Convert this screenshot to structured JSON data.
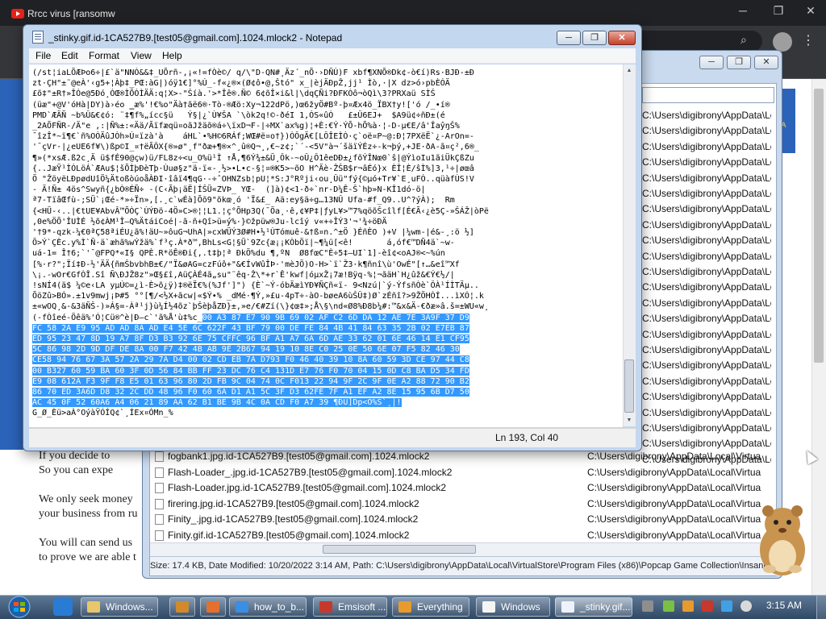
{
  "browser": {
    "tab_title": "Rrcc virus [ransomw",
    "caption_min": "─",
    "caption_max": "❐",
    "caption_close": "✕",
    "page_lines": [
      "If you decide to",
      "So you can expe",
      "We only seek money",
      "your business from ru",
      "You will can send us",
      "to prove we are able t"
    ],
    "side_badge": "CA\nA\nC"
  },
  "explorer": {
    "files": [
      {
        "name": "fogbank1.jpg.id-1CA527B9.[test05@gmail.com].1024.mlock2",
        "path": "C:\\Users\\digibrony\\AppData\\Local\\Virtua"
      },
      {
        "name": "Flash-Loader_.jpg.id-1CA527B9.[test05@gmail.com].1024.mlock2",
        "path": "C:\\Users\\digibrony\\AppData\\Local\\Virtua"
      },
      {
        "name": "Flash-Loader.jpg.id-1CA527B9.[test05@gmail.com].1024.mlock2",
        "path": "C:\\Users\\digibrony\\AppData\\Local\\Virtua"
      },
      {
        "name": "firering.jpg.id-1CA527B9.[test05@gmail.com].1024.mlock2",
        "path": "C:\\Users\\digibrony\\AppData\\Local\\Virtua"
      },
      {
        "name": "Finity_.jpg.id-1CA527B9.[test05@gmail.com].1024.mlock2",
        "path": "C:\\Users\\digibrony\\AppData\\Local\\Virtua"
      },
      {
        "name": "Finity.gif.id-1CA527B9.[test05@gmail.com].1024.mlock2",
        "path": "C:\\Users\\digibrony\\AppData\\Local\\Virtua"
      }
    ],
    "right_paths": [
      "C:\\Users\\digibrony\\AppData\\Local\\Virtua",
      "C:\\Users\\digibrony\\AppData\\Local\\Virtua",
      "C:\\Users\\digibrony\\AppData\\Local\\Virtua",
      "C:\\Users\\digibrony\\AppData\\Local\\Virtua",
      "C:\\Users\\digibrony\\AppData\\Local\\Virtua",
      "C:\\Users\\digibrony\\AppData\\Local\\Virtua",
      "C:\\Users\\digibrony\\AppData\\Local\\Virtua",
      "C:\\Users\\digibrony\\AppData\\Local\\Virtua",
      "C:\\Users\\digibrony\\AppData\\Local\\Virtua",
      "C:\\Users\\digibrony\\AppData\\Local\\Virtua",
      "C:\\Users\\digibrony\\AppData\\Local\\Virtua",
      "C:\\Users\\digibrony\\AppData\\Local\\Virtua",
      "C:\\Users\\digibrony\\AppData\\Local\\Virtua",
      "C:\\Users\\digibrony\\AppData\\Local\\Virtua",
      "C:\\Users\\digibrony\\AppData\\Local\\Virtua",
      "C:\\Users\\digibrony\\AppData\\Local\\Virtua",
      "C:\\Users\\digibrony\\AppData\\Local\\Virtua",
      "C:\\Users\\digibrony\\AppData\\Local\\Virtua",
      "C:\\Users\\digibrony\\AppData\\Local\\Virtua",
      "C:\\Users\\digibrony\\AppData\\Local\\Virtua",
      "C:\\Users\\digibrony\\AppData\\Local\\Virtua",
      "C:\\Users\\digibrony\\AppData\\Local\\Virtua",
      "C:\\Users\\digibrony\\AppData\\Local\\Virtua"
    ],
    "status": "Size: 17.4 KB, Date Modified: 10/20/2022 3:14 AM, Path: C:\\Users\\digibrony\\AppData\\Local\\VirtualStore\\Program Files (x86)\\Popcap Game Collection\\Insaniq",
    "min": "─",
    "max": "❐",
    "close": "✕"
  },
  "notepad": {
    "title": "_stinky.gif.id-1CA527B9.[test05@gmail.com].1024.mlock2 - Notepad",
    "menus": [
      "File",
      "Edit",
      "Format",
      "View",
      "Help"
    ],
    "min": "─",
    "max": "❐",
    "close": "✕",
    "status_position": "Ln 193, Col 40",
    "lines": [
      {
        "t": "(/st¦iaLÕÆÞo6÷|£`ä\"NNÒ&&‡_UÕrñ-,¡«!=fÒè©/ q/\\\"D-QN#¸Äz´_nÕ·›DÑÙ)F xbf¶XNÕ®Dk¢-ò€í)Rs·BJÐ-±Ð"
      },
      {
        "t": "zt·ÇH\"±˜@eÀ'‹g5+¦Àþ‡_PŒ:àG|)óÿ1€]°%Ú_-f«¿®×(Ø¢ô•@,Štó\" x_|èjÄÐpŽ,jj¹ Ìò,·|X dz>ó›pbÈÓÄ"
      },
      {
        "t": "£õ‡\"±R†»ÎÓe@5Ðó¸ÓŒ®ÌÕÒÌÄÄ:q¦X>-\"Šíà.'>*Îê®.Ñ© 6¢õÎ×i&l|\\dqÇÑi?ÐFKÒô¬òQì\\3?PRXaü SÌŠ"
      },
      {
        "t": "(üæ\"+@V'óHà|DY)à›éo ‗æ%'!€%o\"Äà†ãë6®·Tò-®Æö:Xy¬122dPö,)œ6žyÖ#Bº-þ¤Æx4ö_ÏBX†y!['ó /_•í®"
      },
      {
        "t": "PMD`ÆÄÑ ~b%Û&€¢ó: ¨‡¶f%„ícc§ü   Ý§|¿`Ù¥ŠA `\\òk2q!©-ðéI 1,ÓS«ûÒ   £±Û6EJ+  $A9ü¢÷ñÐ±(é"
      },
      {
        "t": "_2AÕFÑR-/Ä\"e ,:|Ñ%±:«Ää/Ãïfæqü¤oãJžäõ®á÷\\ïxD¬F-|÷MX`ax%g)¦+È:€Ý·ÝÕ-hÕ%à·¦-D-µ€E/â'ÎaŷŋŠ%"
      },
      {
        "t": "¯îzÎ*~ï¶€`ñ%OÒÄûJÒh»Ú¤ïzà'à    áHL`•%H©6RÁf;WŒ#ë¤o†})ÒÔgÄ€[LÔÎEÌÒ·ç`oë¤P~@:Ð¦7PXëË`¿-ArOn=-"
      },
      {
        "t": "'¯çVr·|¿eUE6f¥\\)ßp©I_¤†ëÃÔX{®»ø\"¸f\"ðæ+¶®×^¸û®Q¬¸,€~z¢;`´-<5V\"à¬´šäïÝÉz÷-k¬þý,+JE·ðA-ã¤ç²,6®_"
      },
      {
        "t": "¶»(*xsÆ.ß2c¸Ä ü$fÉ90@çw)ü/FL8z÷<u_O%ü¹Ì ↑Å,¶6Ý¾±&Ü¸Ôk-~oÛ¿Ô1êeDÐ±¿fõÝÎNœ0`ŝ|@ÝìoIu1ãiÜkÇßZu"
      },
      {
        "t": "{..JæŸ¹ÌÓLöÁ`ÆAu$¦šÕÌþÐèTþ·Ùuø§z\"ä-ï«-¸½>•L•c-§¦¤®K5>~õO H^Äè-ŽŠB$r¬âÉó}x ÈÎ¦È/ŝÌ%]3,¹÷|øœâ"
      },
      {
        "t": "Ö \"ŽöyëLÐpødUîÖ¼ÄtoßòúoåÀÐI·îâï4¶qG·-÷ˆOHNZsb¦pU¦*S:J°Rºji‹ou¸Ûü\"fý{©µó+Tr¥`E¸uFÓ..qüàfÙS!V"
      },
      {
        "t": "- Ä!Ñ± 4ös^Swyñ{¿bÒ®ÉÑ÷ -(C‹Ãþ¡äË|ÍŠÜ«ZVÞ_ YŒ-  (]à)¢<1-ð÷`nr-D¼Ê-Š`hþ»N-KÎ1dó-ö|"
      },
      {
        "t": "ª7-TïâŒfù-;SÜ`¡Œé-*»÷Ïn»,[.¸c`wÉà]Õõ9\"õkœ¸ó 'Ï&£_ Aä:ey§ä÷g…13NÛ Ufa-#f_Q9..U^?ýÀ);  Rm"
      },
      {
        "t": "{<HÜ-‹..|€tUE¥AbvÂ™ÕÒÇ`ÙÝÐö-4Ö»C>®¦¦L1.¦ç°ÕHp3Q(¯Öa¸·ê,¢¥P‡|ƒyL¥>™7%qöõŠcîlf[É€Ã‹¿è5Ç-»ŠÁŽ|òPë"
      },
      {
        "t": ",0e%ÖÕ'ÎUÌÉ ½õ¢ÀM¹Î—Q%ÄtáiCoé|-ã-ñ+Qî>ü=ý%·}©žpüw®Ju-lcîý v«+÷ÎÝ3'¬'¾÷öÐÄ"
      },
      {
        "t": "'†9*-qzk-¼€0ªÇ58ªiÉU¿ã%!äU~»ôuG¬UhA|»cxWÜÝ3Ø#H•½¹ÙTómuê-&†ß¤n.^±Ö }ÉñÈO )+V |¼wm-|é&-¸:ö ½]"
      },
      {
        "t": "Ö>Ý`ÇÈc.y%Ì`Ñ·ä`æhã%wÝžä%`f³ç.À*ð™,BhLs<G¦§Ü`9Zc{æ¡¡KÒbÖï|~¶¼ü[<ê!       á,óf€™DÑ4ä`~w-"
      },
      {
        "t": "uá-1= Î†6;`'¯@FPQ*«I§ QPÈ.R*öÊ®Ði{,.t‡þ¦ª ÐkÖ%du ¶,ºN  Ø8fœC\"È÷5‡—UI`1]-èî¢<oAJ®<~%ún"
      },
      {
        "t": "[%·r?\";Ïí‡Ð-½'ÄÄ{ñmŠbvbhB±€/\"Ï&øAG=czFúô+\"&€ÍvWûÎÞ·'mèJÖ)O-H>`ï`Ž3·k¶ñnî\\ù'OwÉ\"[↑…&eî™Xf"
      },
      {
        "t": "\\¡.-wOr€GfÒÎ.Sî Ñ\\ÐJŽ8z\"»Œ§£î,AüÇÀÉ4ã„su\"¨êq·Ž\\*+r`Ê'kwf|óµxŽ¡7æ!Bÿq-%¦¬ãäH`H¿ûž&€Ý€½/|"
      },
      {
        "t": "!sNÍ4(ä$ ¼©e‹LA yµÚ©=¿ì-È>õ¿ÿ)‡®ëÏ€%(%Jf']\") {È`~Ý-óbÄæìYÐ¥ÑÇñ«ï- 9<Nzú|`ý-ÝfsñÒè`ÔÀ¹ÍÌTÄµ.."
      },
      {
        "t": "ÕöZû>BÓ».±1v9mwj¡Þ#5 °°[¶/<½X+ãcw|«$Ý•% _dMé·¶Ý,»£u-4pT÷-àO-bøeA6ùŠÛ‡)Ø`zÉñî?>9ŽÖHÓÍ...ìXÓ¦.k"
      },
      {
        "t": "±«wOQ¸&-&3äÑŠ-)»Á§=-Àª¹j}ù¼Í½4õz`þŠèþåZÐ}±,»e/€#Zí(\\}¢œ‡»;Å\\§\\nd«Ø8%Ð8b¼#:™&x&Ä-€ðæ»â.š=±WU«w¸"
      },
      {
        "t": "(-fÒîeé-Öêä%'Ó¦Cü®^è|Ð—c`'ã%Å'ù‡%c_",
        "h": "00 A3 87 E7 90 9B 69 02 AF C2 6D DA 12 AE 7E 3A9F 37 D9"
      },
      {
        "h": "FC 58 2A E9 95 AD AD 8A AD E4 5E 6C 622F 43 BF 79 00 DE FE 84 4B 41 84 63 35 2B 02 E7EB 87"
      },
      {
        "h": "ED 95 23 47 8D 19 A7 8F D3 B3 92 6E 75 CFFC 96 BF A1 A7 6A 6D AE 33 62 01 6E 46 14 E1 CF95"
      },
      {
        "h": "5C 86 98 2D 9D DF DE 8A 00 F7 42 4B AB 9E 2B67 94 19 10 8E C0 25 0E 50 6E 07 F5 82 46 30"
      },
      {
        "h": "CE58 94 76 67 3A 57 2A 29 7A D4 00 02 CD EB 7A D793 F0 46 40 39 10 8A 60 59 3D CE 97 44 C8"
      },
      {
        "h": "00 B327 60 59 BA 60 3F 0D 56 84 BB FF 23 DC 76 C4 131D E7 76 F0 70 04 15 0D C8 BA D5 34 FD"
      },
      {
        "h": "E9 08 612A F3 9F F8 E5 01 63 96 80 2D FB 9C 04 74 0C F013 22 94 9F 2C 9F 0E A2 88 72 90 B2"
      },
      {
        "h": "86 70 ED 3A6D D8 32 2C DD 48 96 F0 60 6A D1 A1 5C 3F D3 62FE 7F A1 EF A2 8E 15 95 6B D7 50"
      },
      {
        "h": "AC 45 0F 52 60A6 A4 06 21 89 AA 62 B1 BE 9B 4C 0A CD F0 A7 39 ¶ÐÜ]Dp<Ô%Ŝ`¸|!"
      },
      {
        "t": "G_Ø_Èü>aÀ°OýàŸÓÍQ¢`¸ÍEx¤ÒMn_%"
      }
    ]
  },
  "taskbar": {
    "items": [
      {
        "label": "Windows...",
        "color": "#e8c66a"
      },
      {
        "label": "",
        "color": "#d08a2c"
      },
      {
        "label": "",
        "color": "#e4702d"
      },
      {
        "label": "how_to_b...",
        "color": "#3b8ee0"
      },
      {
        "label": "Emsisoft ...",
        "color": "#c7382c"
      },
      {
        "label": "Everything",
        "color": "#e89a2c"
      },
      {
        "label": "Windows",
        "color": "#f5f5f5"
      },
      {
        "label": "_stinky.gif...",
        "color": "#eef3fb"
      }
    ],
    "clock": "3:15 AM"
  }
}
